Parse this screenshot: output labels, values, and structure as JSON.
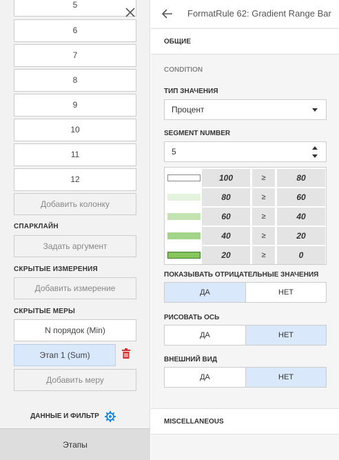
{
  "left_panel": {
    "columns": [
      "5",
      "6",
      "7",
      "8",
      "9",
      "10",
      "11",
      "12"
    ],
    "add_column": "Добавить колонку",
    "sparkline_title": "СПАРКЛАЙН",
    "set_argument": "Задать аргумент",
    "hidden_dims_title": "СКРЫТЫЕ ИЗМЕРЕНИЯ",
    "add_dimension": "Добавить измерение",
    "hidden_measures_title": "СКРЫТЫЕ МЕРЫ",
    "measures": [
      "N порядок (Min)",
      "Этап 1 (Sum)"
    ],
    "add_measure": "Добавить меру",
    "data_filter_label": "ДАННЫЕ И ФИЛЬТР",
    "bottom_tab": "Этапы"
  },
  "right_panel": {
    "title": "FormatRule 62: Gradient Range Bar",
    "general": "ОБЩИЕ",
    "condition": "CONDITION",
    "value_type_label": "ТИП ЗНАЧЕНИЯ",
    "value_type": "Процент",
    "segment_label": "SEGMENT NUMBER",
    "segment_value": "5",
    "ranges": [
      {
        "from": "100",
        "op": "≥",
        "to": "80",
        "color": "#ffffff"
      },
      {
        "from": "80",
        "op": "≥",
        "to": "60",
        "color": "#e4f3dd"
      },
      {
        "from": "60",
        "op": "≥",
        "to": "40",
        "color": "#c3e4b0"
      },
      {
        "from": "40",
        "op": "≥",
        "to": "20",
        "color": "#a2d58a"
      },
      {
        "from": "20",
        "op": "≥",
        "to": "0",
        "color": "#84c65c"
      }
    ],
    "show_negative_label": "ПОКАЗЫВАТЬ ОТРИЦАТЕЛЬНЫЕ ЗНАЧЕНИЯ",
    "draw_axis_label": "РИСОВАТЬ ОСЬ",
    "appearance_label": "ВНЕШНИЙ ВИД",
    "yes": "ДА",
    "no": "НЕТ",
    "show_negative": "yes",
    "draw_axis": "no",
    "appearance": "no",
    "misc": "MISCELLANEOUS"
  },
  "colors": {
    "accent": "#1e88e5",
    "selected": "#d9e8fa",
    "trash": "#d32f2f"
  }
}
